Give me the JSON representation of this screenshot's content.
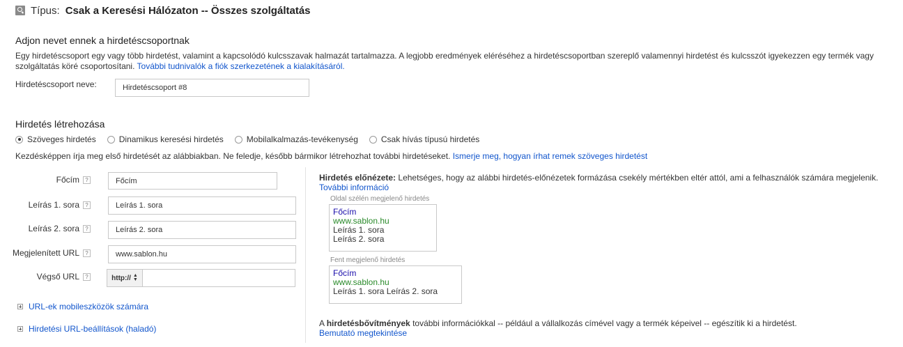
{
  "header": {
    "label": "Típus:",
    "value": "Csak a Keresési Hálózaton -- Összes szolgáltatás"
  },
  "group_section": {
    "title": "Adjon nevet ennek a hirdetéscsoportnak",
    "description": "Egy hirdetéscsoport egy vagy több hirdetést, valamint a kapcsolódó kulcsszavak halmazát tartalmazza. A legjobb eredmények eléréséhez a hirdetéscsoportban szereplő valamennyi hirdetést és kulcsszót igyekezzen egy termék vagy szolgáltatás köré csoportosítani.",
    "link": "További tudnivalók a fiók szerkezetének a kialakításáról.",
    "name_label": "Hirdetéscsoport neve:",
    "name_value": "Hirdetéscsoport #8"
  },
  "ad_section": {
    "title": "Hirdetés létrehozása",
    "ad_types": [
      {
        "label": "Szöveges hirdetés",
        "selected": true
      },
      {
        "label": "Dinamikus keresési hirdetés",
        "selected": false
      },
      {
        "label": "Mobilalkalmazás-tevékenység",
        "selected": false
      },
      {
        "label": "Csak hívás típusú hirdetés",
        "selected": false
      }
    ],
    "intro": "Kezdésképpen írja meg első hirdetését az alábbiakban. Ne feledje, később bármikor létrehozhat további hirdetéseket.",
    "intro_link": "Ismerje meg, hogyan írhat remek szöveges hirdetést"
  },
  "form": {
    "help_glyph": "?",
    "headline": {
      "label": "Főcím",
      "value": "Főcím"
    },
    "desc1": {
      "label": "Leírás 1. sora",
      "value": "Leírás 1. sora"
    },
    "desc2": {
      "label": "Leírás 2. sora",
      "value": "Leírás 2. sora"
    },
    "display_url": {
      "label": "Megjelenített URL",
      "value": "www.sablon.hu"
    },
    "final_url": {
      "label": "Végső URL",
      "protocol": "http://",
      "value": ""
    }
  },
  "expanders": [
    {
      "label": "URL-ek mobileszközök számára",
      "icon": "plus-box-icon"
    },
    {
      "label": "Hirdetési URL-beállítások (haladó)",
      "icon": "plus-box-icon"
    }
  ],
  "preview": {
    "title_bold": "Hirdetés előnézete:",
    "title_rest": "Lehetséges, hogy az alábbi hirdetés-előnézetek formázása csekély mértékben eltér attól, ami a felhasználók számára megjelenik.",
    "more_link": "További információ",
    "side_caption": "Oldal szélén megjelenő hirdetés",
    "top_caption": "Fent megjelenő hirdetés",
    "ad_title": "Főcím",
    "ad_url": "www.sablon.hu",
    "ad_line1": "Leírás 1. sora",
    "ad_line2": "Leírás 2. sora",
    "ad_lines_combined": "Leírás 1. sora Leírás 2. sora"
  },
  "extensions": {
    "prefix": "A",
    "bold": "hirdetésbővítmények",
    "text": "további információkkal -- például a vállalkozás címével vagy a termék képeivel -- egészítik ki a hirdetést.",
    "link": "Bemutató megtekintése"
  },
  "colors": {
    "link": "#1155cc",
    "ad_title": "#1a0dab",
    "ad_url": "#2a8a2a"
  }
}
